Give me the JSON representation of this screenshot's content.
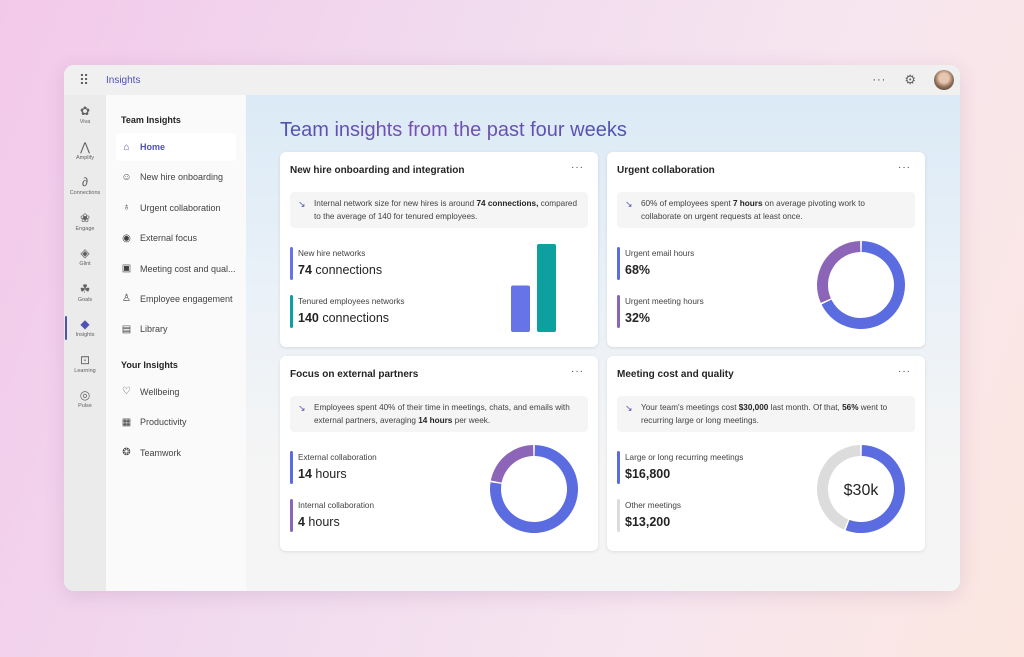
{
  "topbar": {
    "app_name": "Insights",
    "more_icon": "more-icon",
    "settings_icon": "gear-icon"
  },
  "rail": [
    {
      "label": "Viva",
      "icon": "✿"
    },
    {
      "label": "Amplify",
      "icon": "⋀"
    },
    {
      "label": "Connections",
      "icon": "∂"
    },
    {
      "label": "Engage",
      "icon": "❀"
    },
    {
      "label": "Glint",
      "icon": "◈"
    },
    {
      "label": "Goals",
      "icon": "☘"
    },
    {
      "label": "Insights",
      "icon": "◆",
      "active": true
    },
    {
      "label": "Learning",
      "icon": "⊡"
    },
    {
      "label": "Pulse",
      "icon": "◎"
    }
  ],
  "nav": {
    "team_heading": "Team Insights",
    "team_items": [
      {
        "label": "Home",
        "icon": "⌂"
      },
      {
        "label": "New hire onboarding",
        "icon": "☺"
      },
      {
        "label": "Urgent collaboration",
        "icon": "♁"
      },
      {
        "label": "External focus",
        "icon": "◉"
      },
      {
        "label": "Meeting cost and qual...",
        "icon": "▣"
      },
      {
        "label": "Employee engagement",
        "icon": "♙"
      },
      {
        "label": "Library",
        "icon": "▤"
      }
    ],
    "your_heading": "Your Insights",
    "your_items": [
      {
        "label": "Wellbeing",
        "icon": "♡"
      },
      {
        "label": "Productivity",
        "icon": "▦"
      },
      {
        "label": "Teamwork",
        "icon": "❂"
      }
    ]
  },
  "main": {
    "title": "Team insights from the past four weeks"
  },
  "cards": {
    "onboarding": {
      "title": "New hire onboarding and integration",
      "insight_pre": "Internal network size for new hires is around ",
      "insight_bold": "74 connections,",
      "insight_post": " compared to the average of 140 for tenured employees.",
      "m1_label": "New hire networks",
      "m1_num": "74",
      "m1_unit": " connections",
      "m1_color": "#6674e8",
      "m2_label": "Tenured employees networks",
      "m2_num": "140",
      "m2_unit": " connections",
      "m2_color": "#0e9f9f"
    },
    "urgent": {
      "title": "Urgent collaboration",
      "insight_pre": "60% of employees spent ",
      "insight_bold": "7 hours",
      "insight_post": " on average pivoting work to collaborate on urgent requests at least once.",
      "m1_label": "Urgent email hours",
      "m1_value": "68%",
      "m1_color": "#5b6be0",
      "m2_label": "Urgent meeting hours",
      "m2_value": "32%",
      "m2_color": "#8d65b8"
    },
    "external": {
      "title": "Focus on external partners",
      "insight_pre": "Employees spent 40% of their time in meetings, chats, and emails with external partners, averaging ",
      "insight_bold": "14 hours",
      "insight_post": " per week.",
      "m1_label": "External collaboration",
      "m1_num": "14",
      "m1_unit": " hours",
      "m1_color": "#5b6be0",
      "m2_label": "Internal collaboration",
      "m2_num": "4",
      "m2_unit": " hours",
      "m2_color": "#8d65b8"
    },
    "meeting": {
      "title": "Meeting cost and quality",
      "insight_pre": "Your team's meetings cost ",
      "insight_bold": "$30,000",
      "insight_mid": " last month. Of that, ",
      "insight_bold2": "56%",
      "insight_post": " went to recurring large or long meetings.",
      "m1_label": "Large or long recurring meetings",
      "m1_value": "$16,800",
      "m1_color": "#5b6be0",
      "m2_label": "Other meetings",
      "m2_value": "$13,200",
      "m2_color": "#dcdcdc",
      "center_label": "$30k"
    }
  },
  "chart_data": [
    {
      "type": "bar",
      "title": "New hire onboarding and integration",
      "categories": [
        "New hire networks",
        "Tenured employees networks"
      ],
      "values": [
        74,
        140
      ],
      "colors": [
        "#6674e8",
        "#0e9f9f"
      ]
    },
    {
      "type": "pie",
      "title": "Urgent collaboration",
      "categories": [
        "Urgent email hours",
        "Urgent meeting hours"
      ],
      "values": [
        68,
        32
      ],
      "colors": [
        "#5b6be0",
        "#8d65b8"
      ]
    },
    {
      "type": "pie",
      "title": "Focus on external partners",
      "categories": [
        "External collaboration",
        "Internal collaboration"
      ],
      "values": [
        14,
        4
      ],
      "colors": [
        "#5b6be0",
        "#8d65b8"
      ]
    },
    {
      "type": "pie",
      "title": "Meeting cost and quality",
      "categories": [
        "Large or long recurring meetings",
        "Other meetings"
      ],
      "values": [
        16800,
        13200
      ],
      "colors": [
        "#5b6be0",
        "#dcdcdc"
      ],
      "center_label": "$30k"
    }
  ]
}
